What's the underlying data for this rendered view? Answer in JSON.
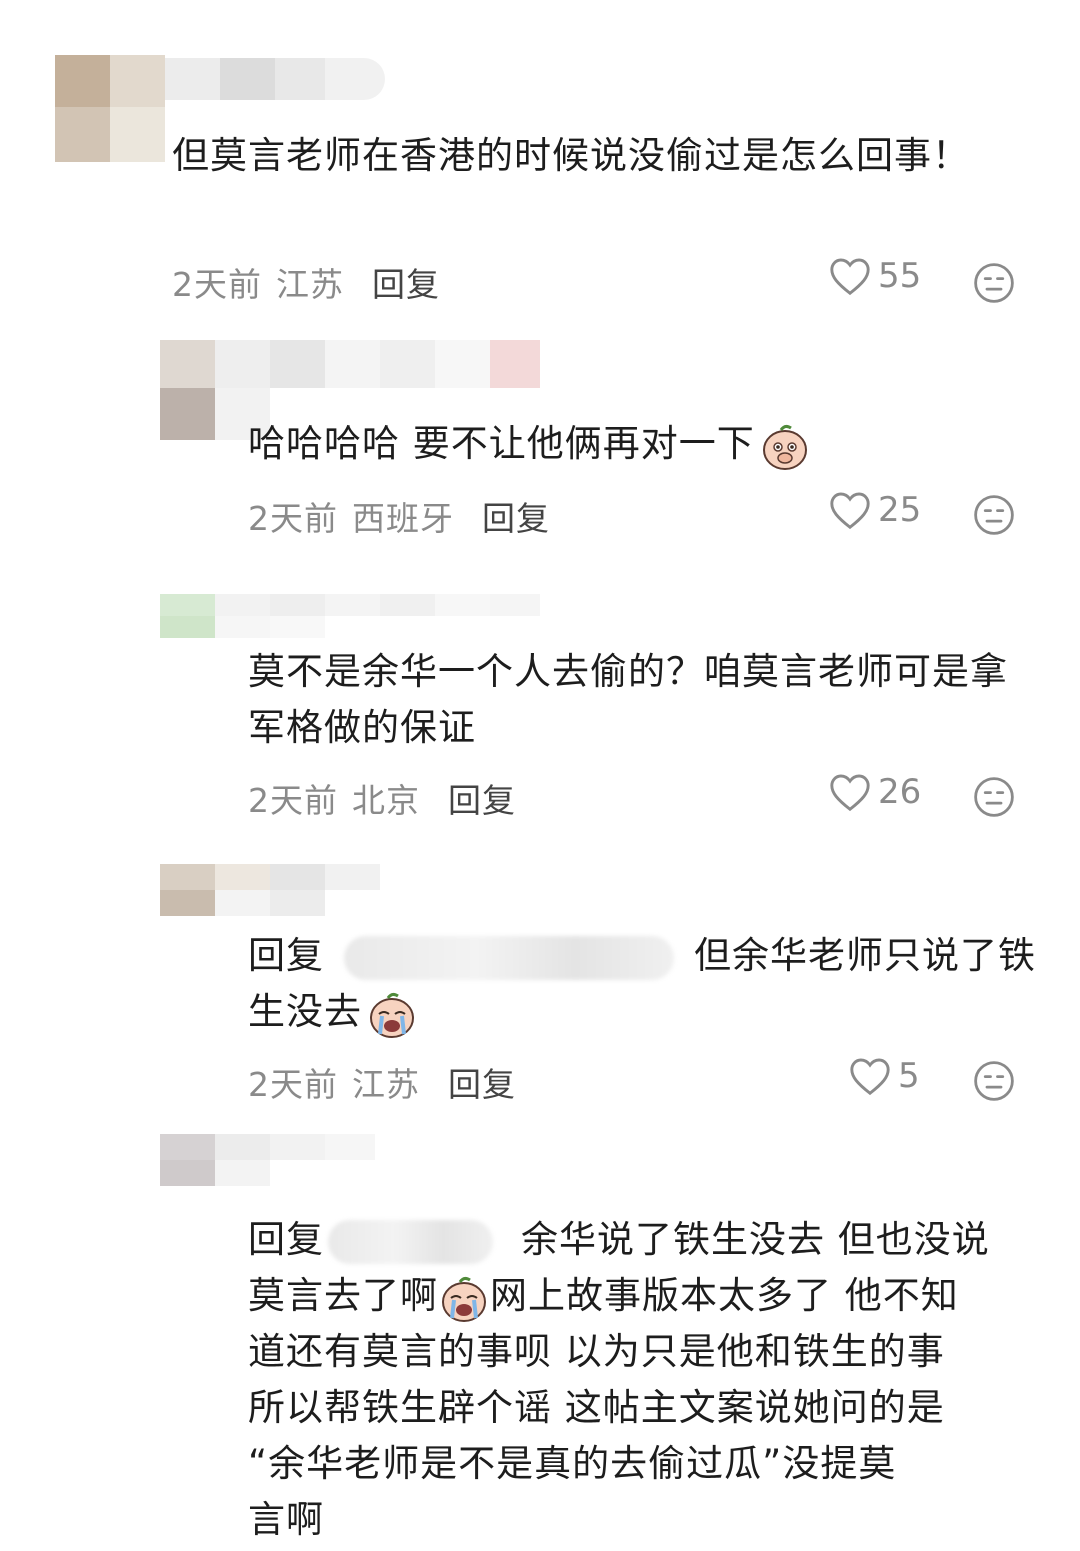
{
  "comments": [
    {
      "text": "但莫言老师在香港的时候说没偷过是怎么回事！",
      "time": "2天前",
      "location": "江苏",
      "reply_label": "回复",
      "likes": "55"
    },
    {
      "text": "哈哈哈哈 要不让他俩再对一下",
      "time": "2天前",
      "location": "西班牙",
      "reply_label": "回复",
      "likes": "25"
    },
    {
      "text": "莫不是余华一个人去偷的？咱莫言老师可是拿军格做的保证",
      "time": "2天前",
      "location": "北京",
      "reply_label": "回复",
      "likes": "26"
    },
    {
      "reply_prefix": "回复",
      "text_a": "但余华老师只说了铁生没去",
      "time": "2天前",
      "location": "江苏",
      "reply_label": "回复",
      "likes": "5"
    },
    {
      "reply_prefix": "回复",
      "line1": "余华说了铁生没去 但也没说",
      "line2a": "莫言去了啊",
      "line2b": "网上故事版本太多了 他不知",
      "line3": "道还有莫言的事呗 以为只是他和铁生的事",
      "line4": "所以帮铁生辟个谣 这帖主文案说她问的是",
      "line5": "“余华老师是不是真的去偷过瓜”没提莫",
      "line6": "言啊"
    }
  ],
  "icons": {
    "like": "heart-outline-icon",
    "dislike": "meh-face-icon",
    "emoji_peach_cover_mouth": "peach-cover-mouth-emoji",
    "emoji_peach_cry": "peach-cry-emoji"
  },
  "colors": {
    "meta_gray": "#8a8a8a",
    "text": "#1d1d1d"
  }
}
